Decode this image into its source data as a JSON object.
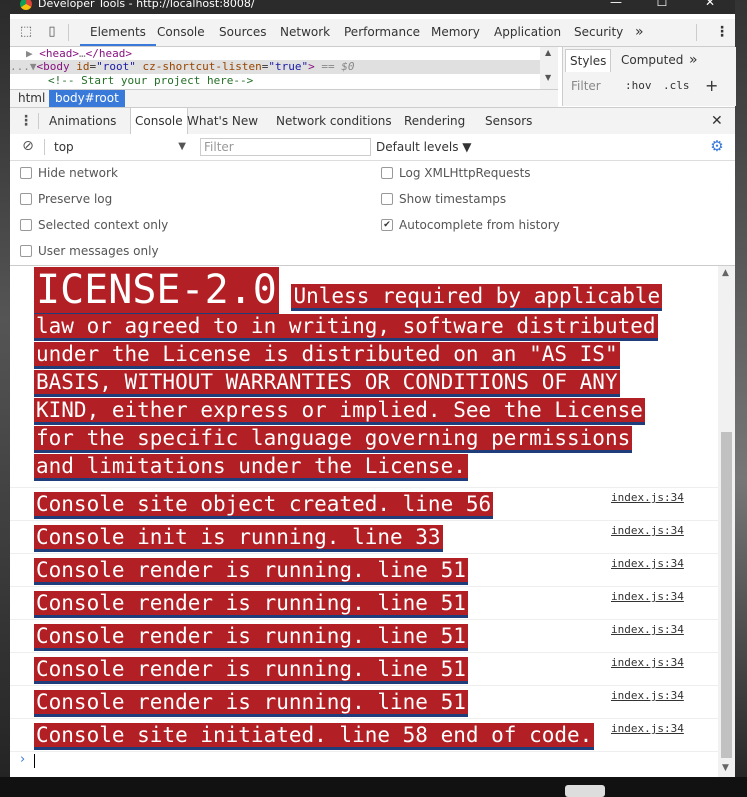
{
  "window": {
    "title": "Developer Tools - http://localhost:8008/",
    "controls": [
      "—",
      "☐",
      "✕"
    ]
  },
  "toolbar": {
    "tabs": [
      "Elements",
      "Console",
      "Sources",
      "Network",
      "Performance",
      "Memory",
      "Application",
      "Security"
    ],
    "more": "»",
    "menu": "⋮"
  },
  "elements_panel": {
    "line1": {
      "arrow": "▶",
      "open": "<head>",
      "ellipsis": "…",
      "close": "</head>"
    },
    "line2": {
      "prefix": "...",
      "arrow": "▼",
      "open_tag": "<body",
      "attr1": "id",
      "val1": "\"root\"",
      "attr2": "cz-shortcut-listen",
      "val2": "\"true\"",
      "end": ">",
      "eq": "== $0"
    },
    "line3": {
      "comment": "<!-- Start your project here-->"
    },
    "breadcrumbs": [
      "html",
      "body#root"
    ]
  },
  "styles_panel": {
    "tabs": [
      "Styles",
      "Computed"
    ],
    "more": "»",
    "filter_placeholder": "Filter",
    "hov": ":hov",
    "cls": ".cls",
    "add": "+"
  },
  "drawer": {
    "tabs": [
      "Animations",
      "Console",
      "What's New",
      "Network conditions",
      "Rendering",
      "Sensors"
    ],
    "close": "✕",
    "menu": "⋮"
  },
  "console_toolbar": {
    "context": "top",
    "filter_placeholder": "Filter",
    "levels": "Default levels ▼"
  },
  "settings": {
    "hide_network": "Hide network",
    "preserve_log": "Preserve log",
    "selected_context_only": "Selected context only",
    "user_messages_only": "User messages only",
    "log_xhr": "Log XMLHttpRequests",
    "show_timestamps": "Show timestamps",
    "autocomplete": "Autocomplete from history",
    "autocomplete_checked": true
  },
  "console": {
    "license_head": "ICENSE-2.0",
    "license_lines": [
      "Unless required by applicable",
      "law or agreed to in writing, software distributed",
      "under the License is distributed on an \"AS IS\"",
      "BASIS, WITHOUT WARRANTIES OR CONDITIONS OF ANY",
      "KIND, either express or implied. See the License",
      "for the specific language governing permissions",
      "and limitations under the License."
    ],
    "messages": [
      {
        "text": "Console site object created. line 56",
        "source": "index.js:34"
      },
      {
        "text": "Console init is running. line 33",
        "source": "index.js:34"
      },
      {
        "text": "Console render is running. line 51",
        "source": "index.js:34"
      },
      {
        "text": "Console render is running. line 51",
        "source": "index.js:34"
      },
      {
        "text": "Console render is running. line 51",
        "source": "index.js:34"
      },
      {
        "text": "Console render is running. line 51",
        "source": "index.js:34"
      },
      {
        "text": "Console render is running. line 51",
        "source": "index.js:34"
      },
      {
        "text": "Console site initiated. line 58 end of code.",
        "source": "index.js:34"
      }
    ],
    "prompt": "›"
  },
  "colors": {
    "highlight_bg": "#b21f24",
    "highlight_shadow": "#1f3d7a",
    "accent": "#3879d9"
  }
}
